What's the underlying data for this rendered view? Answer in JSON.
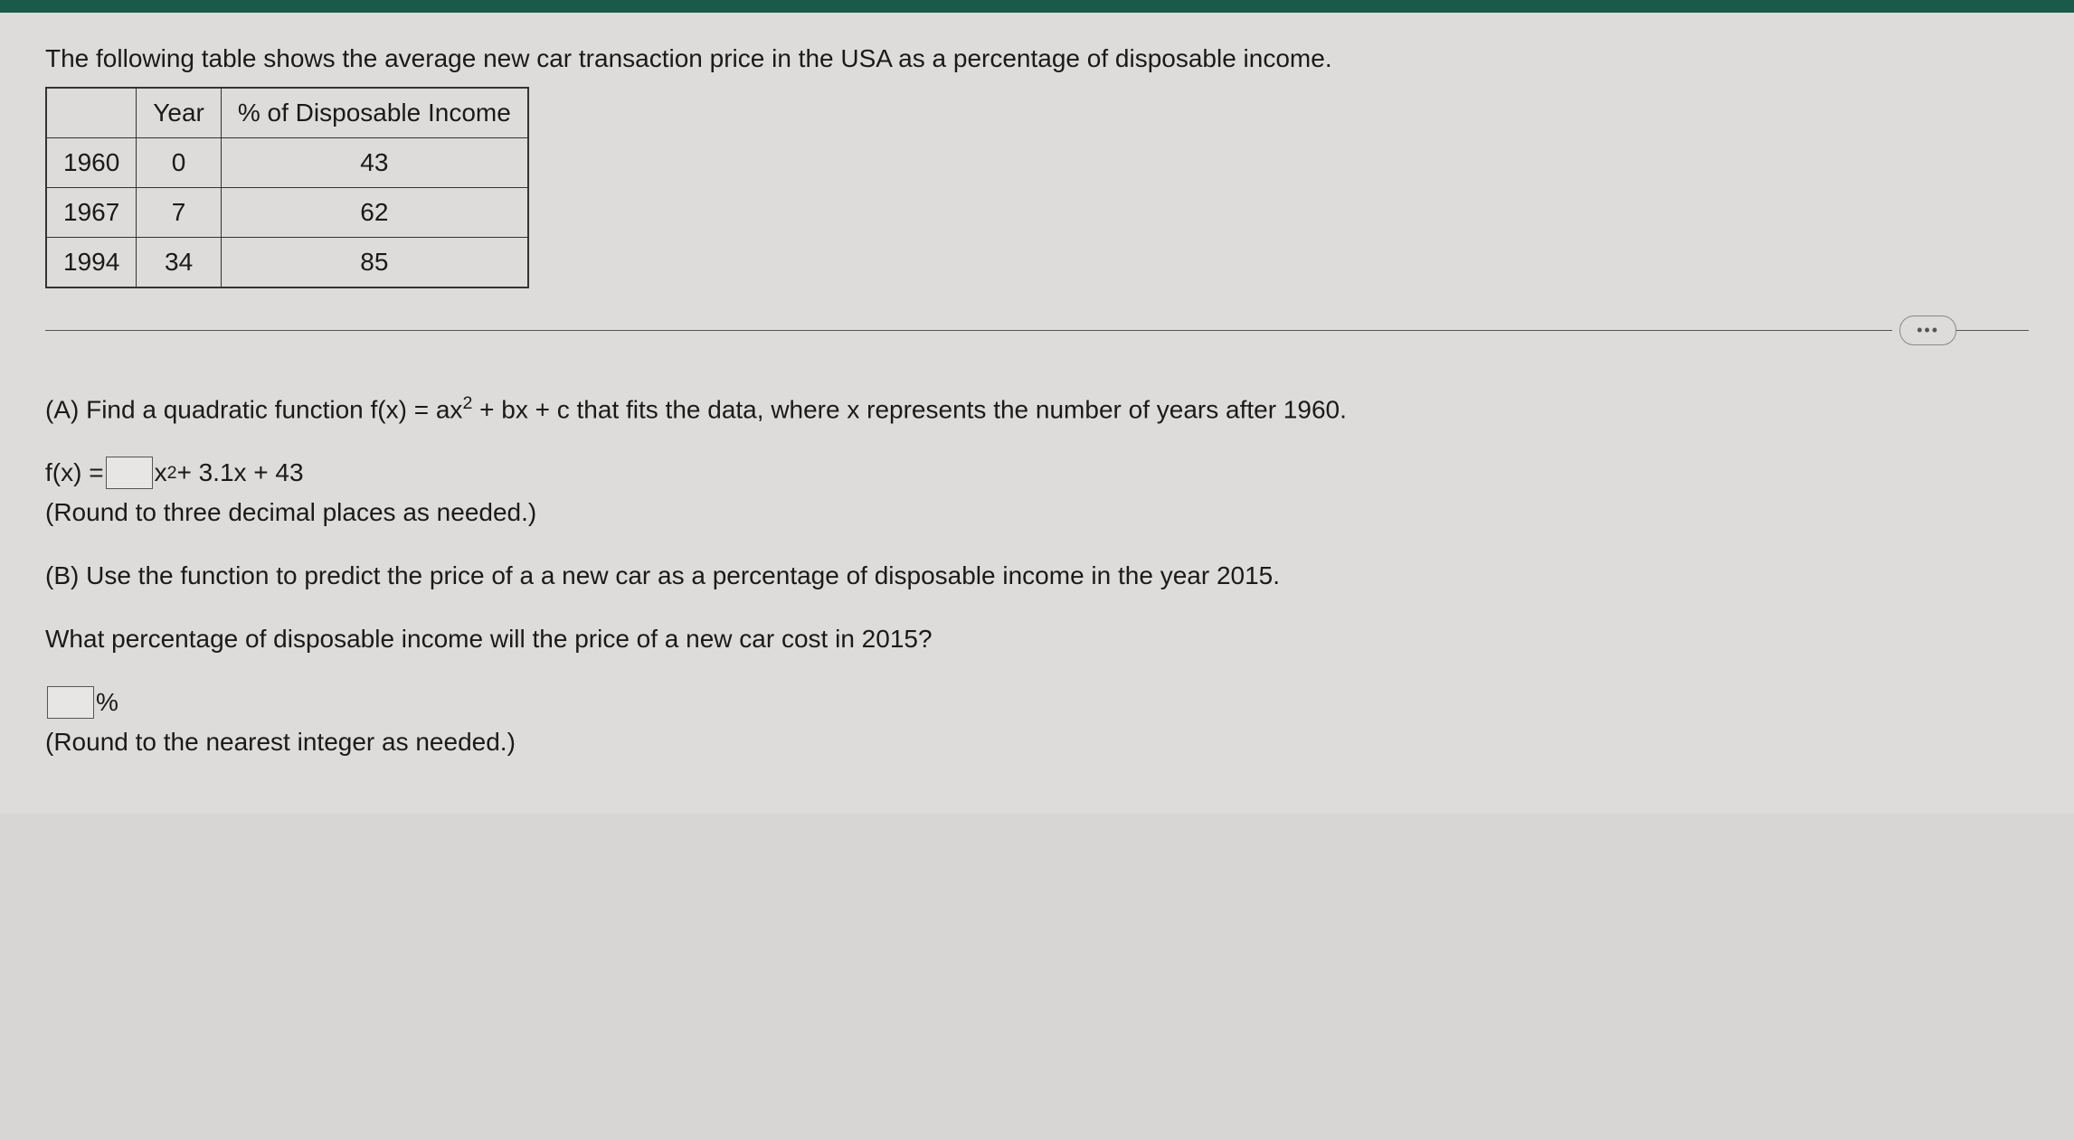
{
  "intro": "The following table shows the average new car transaction price in the USA as a percentage of disposable income.",
  "table": {
    "headers": {
      "blank": "",
      "year": "Year",
      "pct": "% of Disposable Income"
    },
    "rows": [
      {
        "label": "1960",
        "year": "0",
        "pct": "43"
      },
      {
        "label": "1967",
        "year": "7",
        "pct": "62"
      },
      {
        "label": "1994",
        "year": "34",
        "pct": "85"
      }
    ]
  },
  "ellipsis": "•••",
  "partA": {
    "prompt_prefix": "(A) Find a quadratic function f(x) = ax",
    "prompt_suffix": " + bx + c that fits the data, where x represents the number of years after 1960.",
    "formula_prefix": "f(x) = ",
    "formula_mid": "x",
    "formula_suffix": " + 3.1x + 43",
    "hint": "(Round to three decimal places as needed.)"
  },
  "partB": {
    "prompt": "(B) Use the function to predict the price of a a new car as a percentage of disposable income in the year 2015.",
    "question": "What percentage of disposable income will the price of a new car cost in 2015?",
    "unit": "%",
    "hint": "(Round to the nearest integer as needed.)"
  }
}
